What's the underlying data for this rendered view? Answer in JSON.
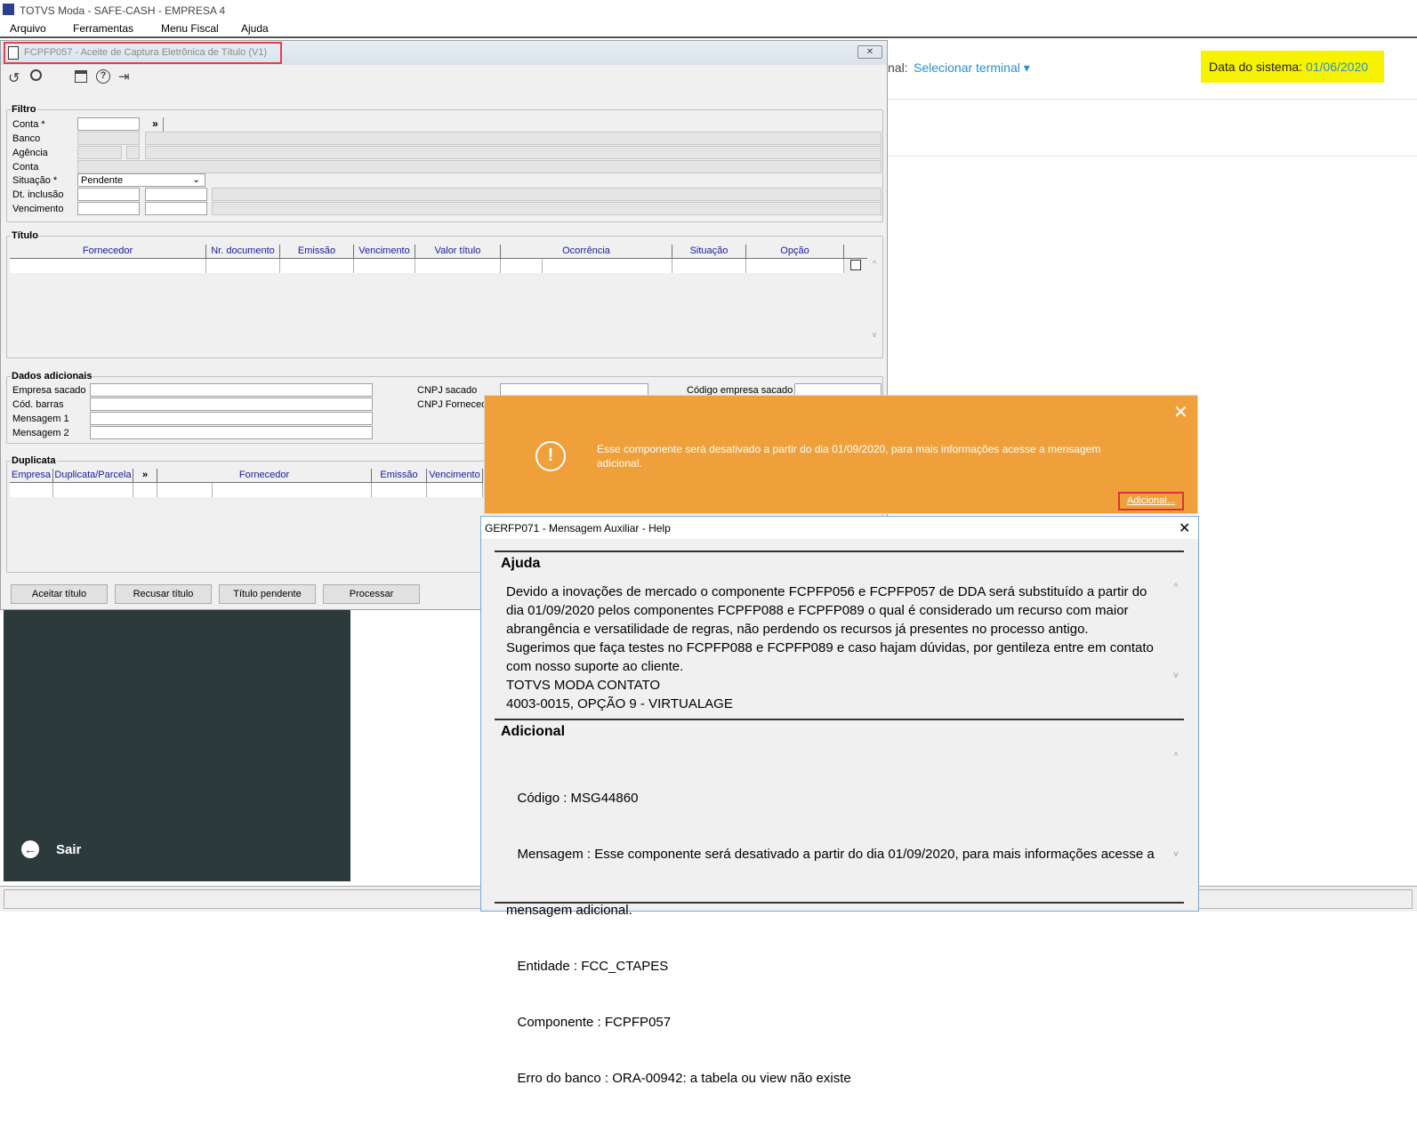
{
  "app": {
    "title": "TOTVS Moda - SAFE-CASH - EMPRESA 4"
  },
  "menu": [
    "Arquivo",
    "Ferramentas",
    "Menu Fiscal",
    "Ajuda"
  ],
  "bg": {
    "terminal_prefix": "nal:",
    "terminal_link": "Selecionar terminal",
    "date_label": "Data do sistema:",
    "date_value": "01/06/2020",
    "sair": "Sair"
  },
  "win": {
    "title": "FCPFP057 - Aceite de Captura Eletrônica de Título (V1)",
    "filtro": {
      "legend": "Filtro",
      "labels": [
        "Conta *",
        "Banco",
        "Agência",
        "Conta",
        "Situação *",
        "Dt. inclusão",
        "Vencimento"
      ],
      "situacao": "Pendente",
      "expand": "»"
    },
    "titulo": {
      "legend": "Título",
      "cols": [
        "Fornecedor",
        "Nr. documento",
        "Emissão",
        "Vencimento",
        "Valor título",
        "Ocorrência",
        "Situação",
        "Opção"
      ]
    },
    "dados": {
      "legend": "Dados adicionais",
      "labels": [
        "Empresa sacado",
        "Cód. barras",
        "Mensagem 1",
        "Mensagem 2"
      ],
      "cnpj_sacado": "CNPJ sacado",
      "cnpj_fornecedor": "CNPJ Fornecedor",
      "cod_empresa": "Código empresa sacado"
    },
    "duplicata": {
      "legend": "Duplicata",
      "cols": [
        "Empresa",
        "Duplicata/Parcela",
        "»",
        "Fornecedor",
        "Emissão",
        "Vencimento"
      ]
    },
    "buttons": [
      "Aceitar título",
      "Recusar título",
      "Título pendente",
      "Processar"
    ]
  },
  "toast": {
    "message": "Esse componente será desativado a partir do dia 01/09/2020, para mais informações acesse a mensagem adicional.",
    "button": "Adicional..."
  },
  "help": {
    "title": "GERFP071 - Mensagem Auxiliar - Help",
    "ajuda_heading": "Ajuda",
    "ajuda_lines": [
      "Devido a inovações de mercado o componente FCPFP056 e FCPFP057 de DDA será substituído a partir do",
      "dia 01/09/2020 pelos componentes FCPFP088 e FCPFP089  o qual é considerado um recurso com maior",
      "abrangência e versatilidade de regras, não perdendo os recursos já presentes no processo antigo.",
      "Sugerimos que faça testes no FCPFP088 e FCPFP089 e caso hajam dúvidas, por gentileza entre em contato",
      "com nosso suporte ao cliente.",
      "TOTVS MODA CONTATO",
      "4003-0015, OPÇÃO 9 - VIRTUALAGE"
    ],
    "adicional_heading": "Adicional",
    "adicional_lines": [
      "   Código : MSG44860",
      "   Mensagem : Esse componente será desativado a partir do dia 01/09/2020, para mais informações acesse a",
      "mensagem adicional.",
      "   Entidade : FCC_CTAPES",
      "   Componente : FCPFP057",
      "   Erro do banco : ORA-00942: a tabela ou view não existe"
    ]
  }
}
